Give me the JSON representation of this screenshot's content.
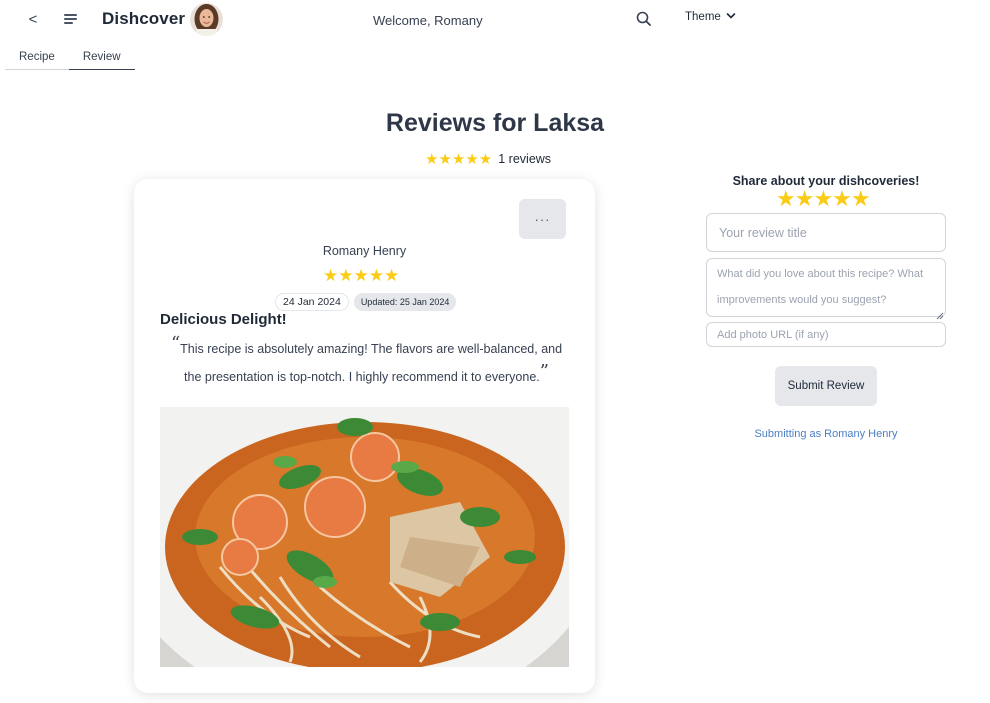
{
  "header": {
    "back_label": "<",
    "brand": "Dishcover",
    "welcome": "Welcome, Romany",
    "theme_label": "Theme"
  },
  "tabs": [
    {
      "label": "Recipe",
      "active": false
    },
    {
      "label": "Review",
      "active": true
    }
  ],
  "page": {
    "title": "Reviews for Laksa",
    "summary_stars": "★★★★★",
    "summary_count": "1 reviews"
  },
  "review": {
    "more_label": "···",
    "reviewer": "Romany Henry",
    "rating_stars": "★★★★★",
    "rating": 5,
    "date": "24 Jan 2024",
    "updated": "Updated: 25 Jan 2024",
    "title": "Delicious Delight!",
    "quote_open": "“",
    "body": "This recipe is absolutely amazing! The flavors are well-balanced, and the presentation is top-notch. I highly recommend it to everyone.",
    "quote_close": "”"
  },
  "form": {
    "heading": "Share about your dishcoveries!",
    "rating_stars": "★★★★★",
    "title_placeholder": "Your review title",
    "body_placeholder": "What did you love about this recipe? What improvements would you suggest?",
    "photo_placeholder": "Add photo URL (if any)",
    "submit_label": "Submit Review",
    "submitting_as": "Submitting as Romany Henry"
  },
  "colors": {
    "star": "#facc15",
    "link": "#4b7fc4",
    "button_bg": "#e5e7eb"
  }
}
